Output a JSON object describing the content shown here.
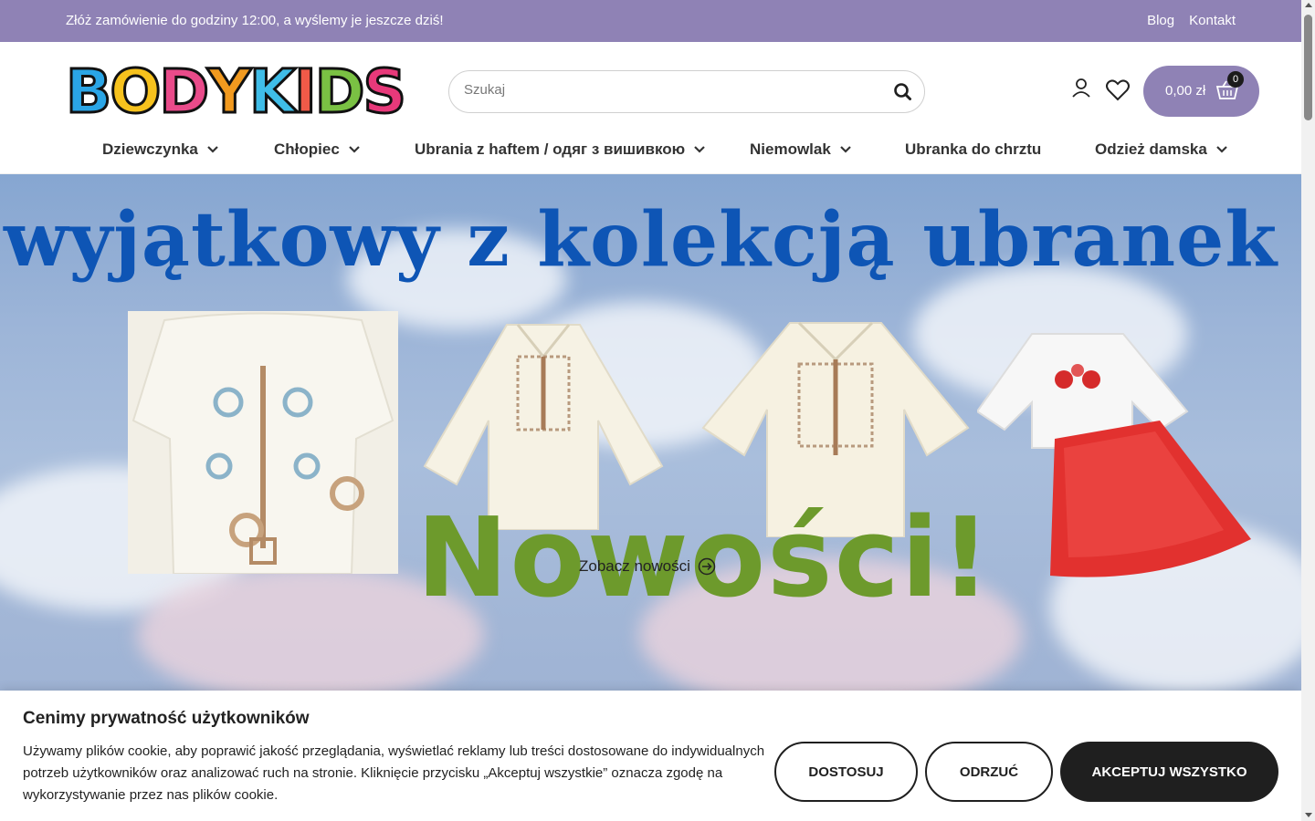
{
  "topbar": {
    "promo": "Złóż zamówienie do godziny 12:00, a wyślemy je jeszcze dziś!",
    "links": [
      "Blog",
      "Kontakt"
    ],
    "bg_color": "#8f82b5"
  },
  "header": {
    "logo_text": "BODYKIDS",
    "logo_letters": [
      "B",
      "O",
      "D",
      "Y",
      "K",
      "I",
      "D",
      "S"
    ],
    "logo_colors": [
      "#2aa5e6",
      "#f7c21d",
      "#e94b8a",
      "#f29a1f",
      "#3fbde8",
      "#f05a48",
      "#7ac143",
      "#e8397a"
    ],
    "search_placeholder": "Szukaj",
    "icons": [
      "account-icon",
      "heart-icon",
      "basket-icon",
      "search-icon"
    ],
    "cart": {
      "amount": "0,00 zł",
      "count": "0",
      "bg_color": "#8f82b5"
    }
  },
  "nav": {
    "items": [
      {
        "label": "Dziewczynka",
        "has_dropdown": true
      },
      {
        "label": "Chłopiec",
        "has_dropdown": true
      },
      {
        "label": "Ubrania z haftem / одяг з вишивкою",
        "has_dropdown": true
      },
      {
        "label": "Niemowlak",
        "has_dropdown": true
      },
      {
        "label": "Ubranka do chrztu",
        "has_dropdown": false
      },
      {
        "label": "Odzież damska",
        "has_dropdown": true
      }
    ]
  },
  "hero": {
    "heading": "wyjątkowy z kolekcją ubranek z haftem",
    "title": "Nowości!",
    "link_label": "Zobacz nowości",
    "heading_color": "#0e55b5",
    "title_color": "#6d9a2c"
  },
  "cookie": {
    "title": "Cenimy prywatność użytkowników",
    "text": "Używamy plików cookie, aby poprawić jakość przeglądania, wyświetlać reklamy lub treści dostosowane do indywidualnych potrzeb użytkowników oraz analizować ruch na stronie. Kliknięcie przycisku „Akceptuj wszystkie” oznacza zgodę na wykorzystywanie przez nas plików cookie.",
    "buttons": {
      "customize": "DOSTOSUJ",
      "reject": "ODRZUĆ",
      "accept": "AKCEPTUJ WSZYSTKO"
    }
  }
}
